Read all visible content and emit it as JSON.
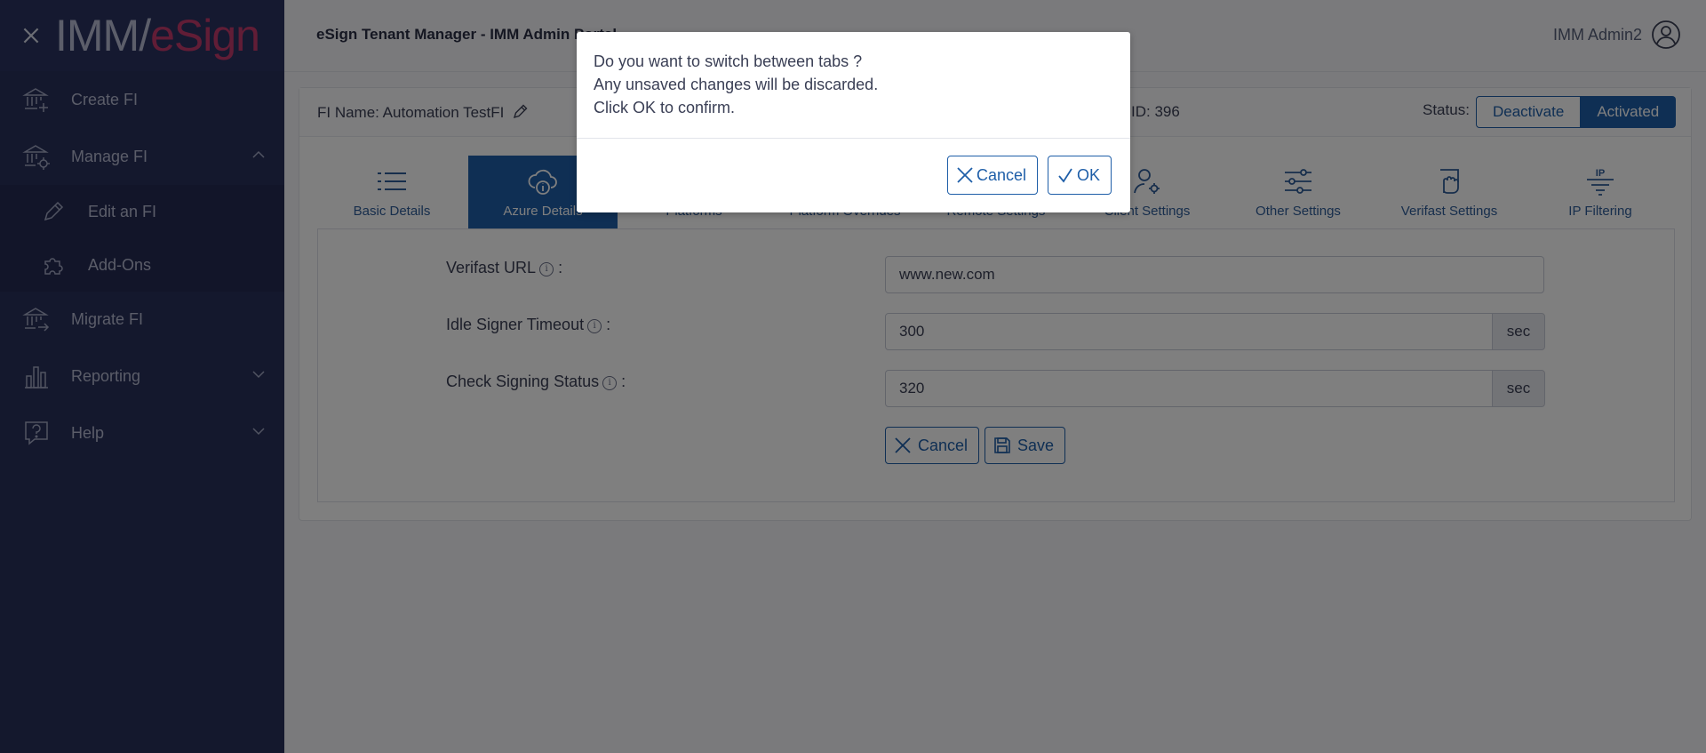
{
  "logo": {
    "imm": "IMM",
    "esign": "eSign"
  },
  "sidebar": {
    "items": [
      {
        "label": "Create FI",
        "icon": "bank-plus-icon"
      },
      {
        "label": "Manage FI",
        "icon": "bank-gear-icon",
        "expanded": true
      },
      {
        "label": "Migrate FI",
        "icon": "bank-arrow-icon"
      },
      {
        "label": "Reporting",
        "icon": "bar-chart-icon"
      },
      {
        "label": "Help",
        "icon": "help-icon"
      }
    ],
    "sub_items": [
      {
        "label": "Edit an FI",
        "icon": "pencil-icon"
      },
      {
        "label": "Add-Ons",
        "icon": "puzzle-icon"
      }
    ]
  },
  "header": {
    "title": "eSign Tenant Manager - IMM Admin Portal",
    "user": "IMM Admin2"
  },
  "fi": {
    "name_label": "FI Name: Automation TestFI",
    "id_label": "ID: 396",
    "status_label": "Status:",
    "deactivate": "Deactivate",
    "activated": "Activated"
  },
  "tabs": [
    {
      "label": "Basic Details",
      "icon": "list-icon"
    },
    {
      "label": "Azure Details",
      "icon": "cloud-info-icon",
      "active": true
    },
    {
      "label": "Platforms",
      "icon": "platforms-icon"
    },
    {
      "label": "Platform Overrides",
      "icon": "override-icon"
    },
    {
      "label": "Remote Settings",
      "icon": "remote-icon"
    },
    {
      "label": "Client Settings",
      "icon": "user-gear-icon"
    },
    {
      "label": "Other Settings",
      "icon": "sliders-icon"
    },
    {
      "label": "Verifast Settings",
      "icon": "hand-doc-icon"
    },
    {
      "label": "IP Filtering",
      "icon": "ip-filter-icon",
      "icon_text": "IP"
    }
  ],
  "form": {
    "verifast_url": {
      "label": "Verifast URL",
      "value": "www.new.com"
    },
    "idle_timeout": {
      "label": "Idle Signer Timeout",
      "value": "300",
      "unit": "sec"
    },
    "check_status": {
      "label": "Check Signing Status",
      "value": "320",
      "unit": "sec"
    },
    "cancel": "Cancel",
    "save": "Save",
    "info_glyph": "i",
    "colon": ":"
  },
  "modal": {
    "line1": "Do you want to switch between tabs ?",
    "line2": "Any unsaved changes will be discarded.",
    "line3": "Click OK to confirm.",
    "cancel": "Cancel",
    "ok": "OK"
  },
  "colors": {
    "sidebar": "#28305a",
    "accent": "#1e5ea8",
    "brand_pink": "#c23a6d"
  }
}
